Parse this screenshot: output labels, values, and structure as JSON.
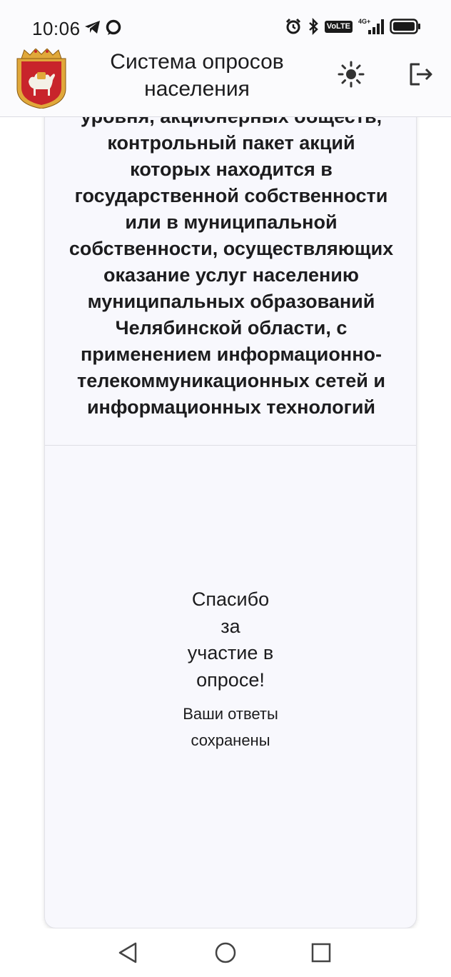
{
  "status_bar": {
    "time": "10:06",
    "left_icons": [
      "telegram-icon",
      "chat-icon"
    ],
    "right_icons": [
      "alarm-icon",
      "bluetooth-icon",
      "volte-icon",
      "signal-4g-icon",
      "battery-icon"
    ],
    "volte_label": "VoLTE",
    "network_label": "4G+"
  },
  "header": {
    "title": "Система опросов населения",
    "emblem": "chelyabinsk-coat-of-arms",
    "theme_icon": "sun-icon",
    "logout_icon": "logout-icon"
  },
  "question": {
    "lines": [
      "уровня, акционерных обществ,",
      "контрольный пакет акций",
      "которых находится в",
      "государственной собственности",
      "или в муниципальной",
      "собственности, осуществляющих",
      "оказание услуг населению",
      "муниципальных образований",
      "Челябинской области, с",
      "применением информационно-",
      "телекоммуникационных сетей и",
      "информационных технологий"
    ]
  },
  "thanks": {
    "title": "Спасибо за участие в опросе!",
    "subtitle": "Ваши ответы сохранены"
  },
  "nav": {
    "back_icon": "back-triangle-icon",
    "home_icon": "home-circle-icon",
    "recents_icon": "recents-square-icon"
  },
  "colors": {
    "background": "#ffffff",
    "header_bg": "#fbfbfd",
    "card_bg": "#f8f8fd",
    "emblem_red": "#c8242b",
    "emblem_gold": "#e0a83a"
  }
}
